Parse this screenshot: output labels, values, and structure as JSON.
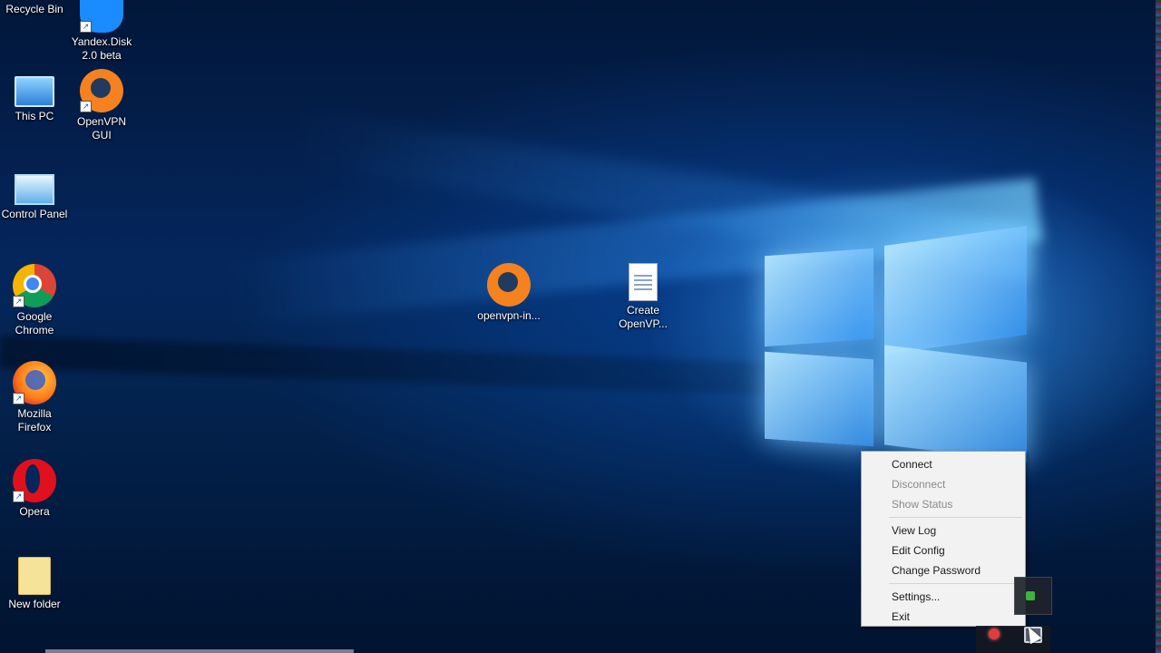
{
  "desktop": {
    "icons": [
      {
        "id": "recycle",
        "label": "Recycle Bin",
        "shortcut": false
      },
      {
        "id": "yandex",
        "label": "Yandex.Disk 2.0 beta",
        "shortcut": true
      },
      {
        "id": "thispc",
        "label": "This PC",
        "shortcut": false
      },
      {
        "id": "openvpn-gui",
        "label": "OpenVPN GUI",
        "shortcut": true
      },
      {
        "id": "control-panel",
        "label": "Control Panel",
        "shortcut": false
      },
      {
        "id": "chrome",
        "label": "Google Chrome",
        "shortcut": true
      },
      {
        "id": "firefox",
        "label": "Mozilla Firefox",
        "shortcut": true
      },
      {
        "id": "opera",
        "label": "Opera",
        "shortcut": true
      },
      {
        "id": "new-folder",
        "label": "New folder",
        "shortcut": false
      },
      {
        "id": "openvpn-installer",
        "label": "openvpn-in...",
        "shortcut": false
      },
      {
        "id": "create-openvpn",
        "label": "Create OpenVP...",
        "shortcut": false
      }
    ]
  },
  "context_menu": {
    "items": [
      {
        "label": "Connect",
        "enabled": true
      },
      {
        "label": "Disconnect",
        "enabled": false
      },
      {
        "label": "Show Status",
        "enabled": false
      },
      {
        "label": "View Log",
        "enabled": true
      },
      {
        "label": "Edit Config",
        "enabled": true
      },
      {
        "label": "Change Password",
        "enabled": true
      },
      {
        "label": "Settings...",
        "enabled": true
      },
      {
        "label": "Exit",
        "enabled": true
      }
    ]
  },
  "tray": {
    "icons": [
      "shield-check-icon",
      "red-status-icon",
      "openvpn-tray-icon"
    ]
  },
  "colors": {
    "desktop_bg": "#04265c",
    "menu_bg": "#f2f2f2",
    "menu_disabled": "#8a8a8a"
  }
}
